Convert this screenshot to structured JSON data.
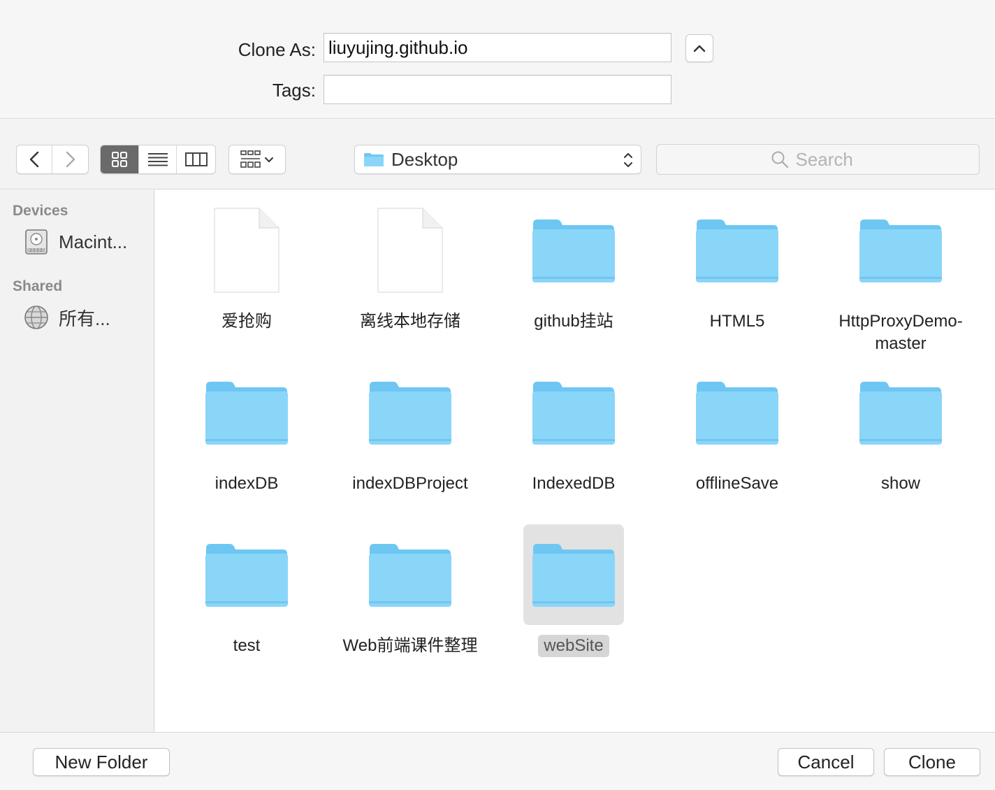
{
  "header": {
    "clone_as_label": "Clone As:",
    "clone_as_value": "liuyujing.github.io",
    "tags_label": "Tags:",
    "tags_value": ""
  },
  "toolbar": {
    "location": "Desktop",
    "search_placeholder": "Search",
    "active_view": "icon"
  },
  "sidebar": {
    "devices_header": "Devices",
    "devices": [
      {
        "label": "Macint...",
        "icon": "hard-drive-icon"
      }
    ],
    "shared_header": "Shared",
    "shared": [
      {
        "label": "所有...",
        "icon": "network-globe-icon"
      }
    ]
  },
  "items": [
    {
      "name": "爱抢购",
      "kind": "document"
    },
    {
      "name": "离线本地存储",
      "kind": "document"
    },
    {
      "name": "github挂站",
      "kind": "folder"
    },
    {
      "name": "HTML5",
      "kind": "folder"
    },
    {
      "name": "HttpProxyDemo-master",
      "kind": "folder"
    },
    {
      "name": "indexDB",
      "kind": "folder"
    },
    {
      "name": "indexDBProject",
      "kind": "folder"
    },
    {
      "name": "IndexedDB",
      "kind": "folder"
    },
    {
      "name": "offlineSave",
      "kind": "folder"
    },
    {
      "name": "show",
      "kind": "folder"
    },
    {
      "name": "test",
      "kind": "folder"
    },
    {
      "name": "Web前端课件整理",
      "kind": "folder"
    },
    {
      "name": "webSite",
      "kind": "folder",
      "selected": true
    }
  ],
  "footer": {
    "new_folder": "New Folder",
    "cancel": "Cancel",
    "clone": "Clone"
  },
  "colors": {
    "folder_body": "#7dd0f7",
    "folder_tab": "#8ad6f9",
    "selection": "#e2e2e2"
  }
}
